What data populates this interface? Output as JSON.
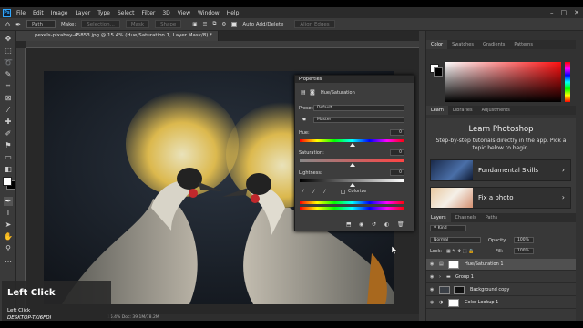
{
  "menubar": {
    "logo": "Ps",
    "items": [
      "File",
      "Edit",
      "Image",
      "Layer",
      "Type",
      "Select",
      "Filter",
      "3D",
      "View",
      "Window",
      "Help"
    ],
    "window_controls": [
      "–",
      "□",
      "✕"
    ]
  },
  "options_bar": {
    "tool_mode": "Path",
    "make_label": "Make:",
    "buttons": [
      "Selection...",
      "Mask",
      "Shape"
    ],
    "auto_add_delete": "Auto Add/Delete",
    "align_edges": "Align Edges"
  },
  "document": {
    "tab_title": "pexels-pixabay-45853.jpg @ 15.4% (Hue/Saturation 1, Layer Mask/8) *",
    "status": "15.4%   Doc: 39.1M/78.2M"
  },
  "properties": {
    "panel_title": "Properties",
    "adjustment_name": "Hue/Saturation",
    "preset_label": "Preset:",
    "preset_value": "Default",
    "channel_value": "Master",
    "hue_label": "Hue:",
    "hue_value": "0",
    "saturation_label": "Saturation:",
    "saturation_value": "0",
    "lightness_label": "Lightness:",
    "lightness_value": "0",
    "colorize_label": "Colorize"
  },
  "color_panel": {
    "tabs": [
      "Color",
      "Swatches",
      "Gradients",
      "Patterns"
    ],
    "active_tab": "Color",
    "hue_color": "#ff1010"
  },
  "learn_panel": {
    "tabs": [
      "Learn",
      "Libraries",
      "Adjustments"
    ],
    "title": "Learn Photoshop",
    "description": "Step-by-step tutorials directly in the app. Pick a topic below to begin.",
    "cards": [
      {
        "label": "Fundamental Skills"
      },
      {
        "label": "Fix a photo"
      }
    ]
  },
  "layers_panel": {
    "tabs": [
      "Layers",
      "Channels",
      "Paths"
    ],
    "filter_label": "Kind",
    "blend_mode": "Normal",
    "opacity_label": "Opacity:",
    "opacity_value": "100%",
    "lock_label": "Lock:",
    "fill_label": "Fill:",
    "fill_value": "100%",
    "layers": [
      {
        "name": "Hue/Saturation 1",
        "selected": true
      },
      {
        "name": "Group 1",
        "selected": false
      },
      {
        "name": "Background copy",
        "selected": false
      },
      {
        "name": "Color Lookup 1",
        "selected": false
      }
    ]
  },
  "overlay": {
    "title": "Left Click",
    "action": "Left Click",
    "machine": "DESKTOP-TKI6FDI"
  }
}
